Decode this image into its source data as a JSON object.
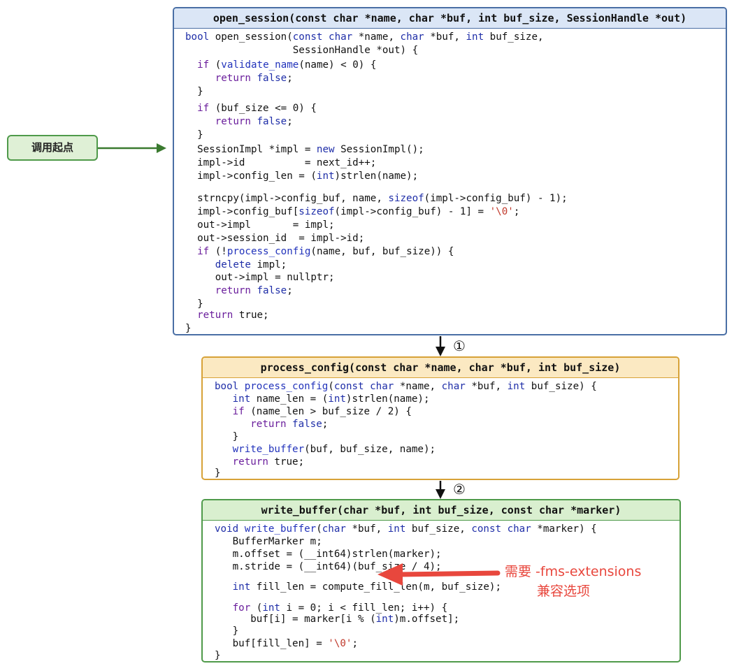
{
  "start_node": {
    "label": "调用起点"
  },
  "step_labels": [
    "①",
    "②"
  ],
  "note": {
    "line1": "需要 -fms-extensions",
    "line2": "兼容选项"
  },
  "boxes": {
    "open_session": {
      "header": "open_session(const char *name, char *buf, int buf_size, SessionHandle *out)",
      "lines": [
        "bool open_session(const char *name, char *buf, int buf_size,",
        "                  SessionHandle *out) {",
        "  if (validate_name(name) < 0) {",
        "     return false;",
        "  }",
        "  if (buf_size <= 0) {",
        "     return false;",
        "  }",
        "  SessionImpl *impl = new SessionImpl();",
        "  impl->id          = next_id++;",
        "  impl->config_len = (int)strlen(name);",
        "  strncpy(impl->config_buf, name, sizeof(impl->config_buf) - 1);",
        "  impl->config_buf[sizeof(impl->config_buf) - 1] = '\\0';",
        "  out->impl       = impl;",
        "  out->session_id  = impl->id;",
        "  if (!process_config(name, buf, buf_size)) {",
        "     delete impl;",
        "     out->impl = nullptr;",
        "     return false;",
        "  }",
        "  return true;",
        "}"
      ]
    },
    "process_config": {
      "header": "process_config(const char *name, char *buf, int buf_size)",
      "lines": [
        "bool process_config(const char *name, char *buf, int buf_size) {",
        "   int name_len = (int)strlen(name);",
        "   if (name_len > buf_size / 2) {",
        "      return false;",
        "   }",
        "   write_buffer(buf, buf_size, name);",
        "   return true;",
        "}"
      ]
    },
    "write_buffer": {
      "header": "write_buffer(char *buf, int buf_size, const char *marker)",
      "lines": [
        "void write_buffer(char *buf, int buf_size, const char *marker) {",
        "   BufferMarker m;",
        "   m.offset = (__int64)strlen(marker);",
        "   m.stride = (__int64)(buf_size / 4);",
        "   int fill_len = compute_fill_len(m, buf_size);",
        "   for (int i = 0; i < fill_len; i++) {",
        "      buf[i] = marker[i % (int)m.offset];",
        "   }",
        "   buf[fill_len] = '\\0';",
        "}"
      ]
    }
  }
}
